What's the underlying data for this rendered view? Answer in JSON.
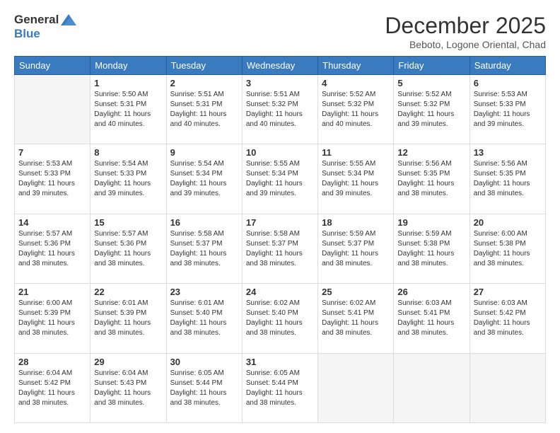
{
  "logo": {
    "general": "General",
    "blue": "Blue"
  },
  "title": "December 2025",
  "location": "Beboto, Logone Oriental, Chad",
  "days": [
    "Sunday",
    "Monday",
    "Tuesday",
    "Wednesday",
    "Thursday",
    "Friday",
    "Saturday"
  ],
  "weeks": [
    [
      {
        "day": "",
        "sunrise": "",
        "sunset": "",
        "daylight": ""
      },
      {
        "day": "1",
        "sunrise": "Sunrise: 5:50 AM",
        "sunset": "Sunset: 5:31 PM",
        "daylight": "Daylight: 11 hours and 40 minutes."
      },
      {
        "day": "2",
        "sunrise": "Sunrise: 5:51 AM",
        "sunset": "Sunset: 5:31 PM",
        "daylight": "Daylight: 11 hours and 40 minutes."
      },
      {
        "day": "3",
        "sunrise": "Sunrise: 5:51 AM",
        "sunset": "Sunset: 5:32 PM",
        "daylight": "Daylight: 11 hours and 40 minutes."
      },
      {
        "day": "4",
        "sunrise": "Sunrise: 5:52 AM",
        "sunset": "Sunset: 5:32 PM",
        "daylight": "Daylight: 11 hours and 40 minutes."
      },
      {
        "day": "5",
        "sunrise": "Sunrise: 5:52 AM",
        "sunset": "Sunset: 5:32 PM",
        "daylight": "Daylight: 11 hours and 39 minutes."
      },
      {
        "day": "6",
        "sunrise": "Sunrise: 5:53 AM",
        "sunset": "Sunset: 5:33 PM",
        "daylight": "Daylight: 11 hours and 39 minutes."
      }
    ],
    [
      {
        "day": "7",
        "sunrise": "Sunrise: 5:53 AM",
        "sunset": "Sunset: 5:33 PM",
        "daylight": "Daylight: 11 hours and 39 minutes."
      },
      {
        "day": "8",
        "sunrise": "Sunrise: 5:54 AM",
        "sunset": "Sunset: 5:33 PM",
        "daylight": "Daylight: 11 hours and 39 minutes."
      },
      {
        "day": "9",
        "sunrise": "Sunrise: 5:54 AM",
        "sunset": "Sunset: 5:34 PM",
        "daylight": "Daylight: 11 hours and 39 minutes."
      },
      {
        "day": "10",
        "sunrise": "Sunrise: 5:55 AM",
        "sunset": "Sunset: 5:34 PM",
        "daylight": "Daylight: 11 hours and 39 minutes."
      },
      {
        "day": "11",
        "sunrise": "Sunrise: 5:55 AM",
        "sunset": "Sunset: 5:34 PM",
        "daylight": "Daylight: 11 hours and 39 minutes."
      },
      {
        "day": "12",
        "sunrise": "Sunrise: 5:56 AM",
        "sunset": "Sunset: 5:35 PM",
        "daylight": "Daylight: 11 hours and 38 minutes."
      },
      {
        "day": "13",
        "sunrise": "Sunrise: 5:56 AM",
        "sunset": "Sunset: 5:35 PM",
        "daylight": "Daylight: 11 hours and 38 minutes."
      }
    ],
    [
      {
        "day": "14",
        "sunrise": "Sunrise: 5:57 AM",
        "sunset": "Sunset: 5:36 PM",
        "daylight": "Daylight: 11 hours and 38 minutes."
      },
      {
        "day": "15",
        "sunrise": "Sunrise: 5:57 AM",
        "sunset": "Sunset: 5:36 PM",
        "daylight": "Daylight: 11 hours and 38 minutes."
      },
      {
        "day": "16",
        "sunrise": "Sunrise: 5:58 AM",
        "sunset": "Sunset: 5:37 PM",
        "daylight": "Daylight: 11 hours and 38 minutes."
      },
      {
        "day": "17",
        "sunrise": "Sunrise: 5:58 AM",
        "sunset": "Sunset: 5:37 PM",
        "daylight": "Daylight: 11 hours and 38 minutes."
      },
      {
        "day": "18",
        "sunrise": "Sunrise: 5:59 AM",
        "sunset": "Sunset: 5:37 PM",
        "daylight": "Daylight: 11 hours and 38 minutes."
      },
      {
        "day": "19",
        "sunrise": "Sunrise: 5:59 AM",
        "sunset": "Sunset: 5:38 PM",
        "daylight": "Daylight: 11 hours and 38 minutes."
      },
      {
        "day": "20",
        "sunrise": "Sunrise: 6:00 AM",
        "sunset": "Sunset: 5:38 PM",
        "daylight": "Daylight: 11 hours and 38 minutes."
      }
    ],
    [
      {
        "day": "21",
        "sunrise": "Sunrise: 6:00 AM",
        "sunset": "Sunset: 5:39 PM",
        "daylight": "Daylight: 11 hours and 38 minutes."
      },
      {
        "day": "22",
        "sunrise": "Sunrise: 6:01 AM",
        "sunset": "Sunset: 5:39 PM",
        "daylight": "Daylight: 11 hours and 38 minutes."
      },
      {
        "day": "23",
        "sunrise": "Sunrise: 6:01 AM",
        "sunset": "Sunset: 5:40 PM",
        "daylight": "Daylight: 11 hours and 38 minutes."
      },
      {
        "day": "24",
        "sunrise": "Sunrise: 6:02 AM",
        "sunset": "Sunset: 5:40 PM",
        "daylight": "Daylight: 11 hours and 38 minutes."
      },
      {
        "day": "25",
        "sunrise": "Sunrise: 6:02 AM",
        "sunset": "Sunset: 5:41 PM",
        "daylight": "Daylight: 11 hours and 38 minutes."
      },
      {
        "day": "26",
        "sunrise": "Sunrise: 6:03 AM",
        "sunset": "Sunset: 5:41 PM",
        "daylight": "Daylight: 11 hours and 38 minutes."
      },
      {
        "day": "27",
        "sunrise": "Sunrise: 6:03 AM",
        "sunset": "Sunset: 5:42 PM",
        "daylight": "Daylight: 11 hours and 38 minutes."
      }
    ],
    [
      {
        "day": "28",
        "sunrise": "Sunrise: 6:04 AM",
        "sunset": "Sunset: 5:42 PM",
        "daylight": "Daylight: 11 hours and 38 minutes."
      },
      {
        "day": "29",
        "sunrise": "Sunrise: 6:04 AM",
        "sunset": "Sunset: 5:43 PM",
        "daylight": "Daylight: 11 hours and 38 minutes."
      },
      {
        "day": "30",
        "sunrise": "Sunrise: 6:05 AM",
        "sunset": "Sunset: 5:44 PM",
        "daylight": "Daylight: 11 hours and 38 minutes."
      },
      {
        "day": "31",
        "sunrise": "Sunrise: 6:05 AM",
        "sunset": "Sunset: 5:44 PM",
        "daylight": "Daylight: 11 hours and 38 minutes."
      },
      {
        "day": "",
        "sunrise": "",
        "sunset": "",
        "daylight": ""
      },
      {
        "day": "",
        "sunrise": "",
        "sunset": "",
        "daylight": ""
      },
      {
        "day": "",
        "sunrise": "",
        "sunset": "",
        "daylight": ""
      }
    ]
  ]
}
